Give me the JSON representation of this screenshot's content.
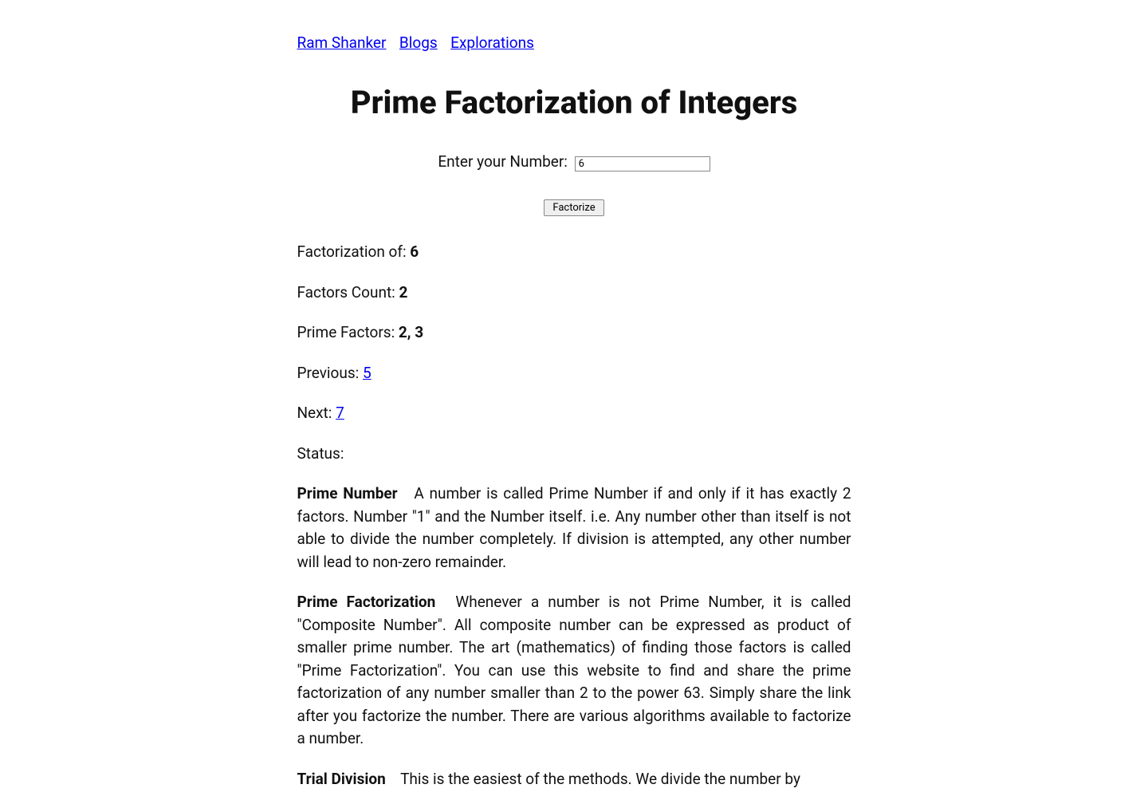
{
  "nav": {
    "home": "Ram Shanker",
    "blogs": "Blogs",
    "explorations": "Explorations"
  },
  "title": "Prime Factorization of Integers",
  "form": {
    "label": "Enter your Number: ",
    "value": "6",
    "button": "Factorize"
  },
  "results": {
    "factorization_of_label": "Factorization of: ",
    "factorization_of_value": "6",
    "factors_count_label": "Factors Count: ",
    "factors_count_value": "2",
    "prime_factors_label": "Prime Factors: ",
    "prime_factors_value": "2, 3",
    "previous_label": "Previous: ",
    "previous_value": "5",
    "next_label": "Next: ",
    "next_value": "7",
    "status_label": "Status:"
  },
  "explain": {
    "prime_number_term": "Prime Number",
    "prime_number_text": "A number is called Prime Number if and only if it has exactly 2 factors. Number \"1\" and the Number itself. i.e. Any number other than itself is not able to divide the number completely. If division is attempted, any other number will lead to non-zero remainder.",
    "prime_factorization_term": "Prime Factorization",
    "prime_factorization_text": "Whenever a number is not Prime Number, it is called \"Composite Number\". All composite number can be expressed as product of smaller prime number. The art (mathematics) of finding those factors is called \"Prime Factorization\". You can use this website to find and share the prime factorization of any number smaller than 2 to the power 63. Simply share the link after you factorize the number. There are various algorithms available to factorize a number.",
    "trial_division_term": "Trial Division",
    "trial_division_text": "This is the easiest of the methods. We divide the number by"
  }
}
